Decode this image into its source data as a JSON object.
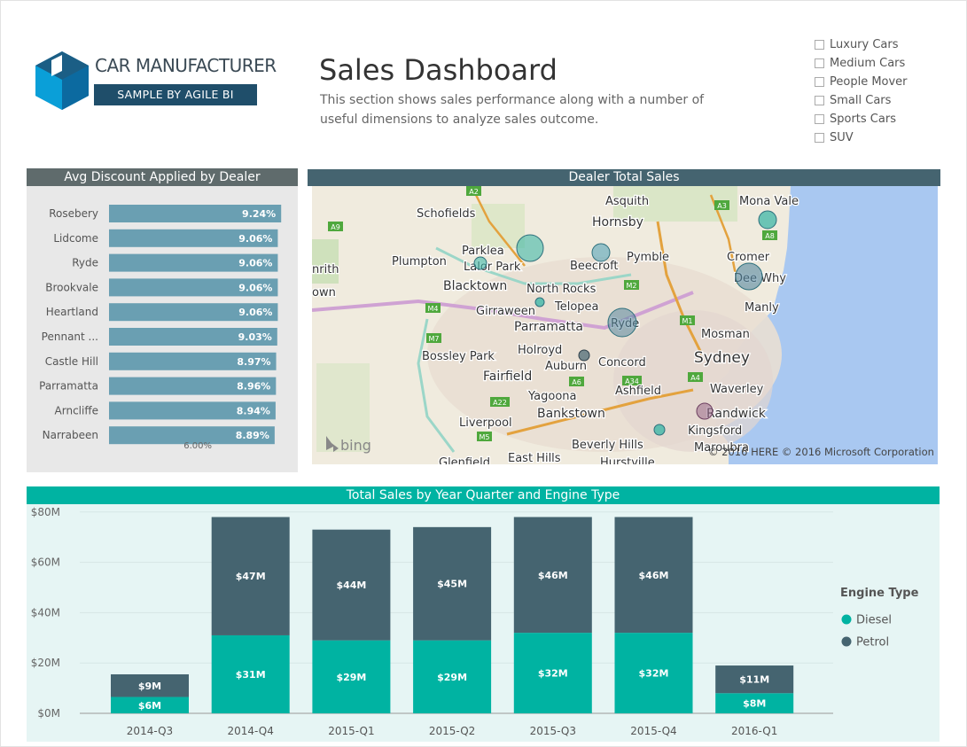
{
  "header": {
    "brand_name": "CAR MANUFACTURER",
    "brand_sub": "SAMPLE BY AGILE BI",
    "title": "Sales Dashboard",
    "description": "This section shows sales performance along with a number of useful dimensions to analyze sales outcome."
  },
  "slicer": {
    "items": [
      "Luxury Cars",
      "Medium Cars",
      "People Mover",
      "Small Cars",
      "Sports Cars",
      "SUV"
    ]
  },
  "colors": {
    "discount_bar": "#6a9fb2",
    "map_header": "#456470",
    "diesel": "#00b3a2",
    "petrol": "#456470",
    "sales_header": "#00b3a2"
  },
  "map": {
    "title": "Dealer Total Sales",
    "attribution": "© 2016 HERE   © 2016 Microsoft Corporation",
    "bing_logo": "bing",
    "places": [
      "Schofields",
      "Asquith",
      "Mona Vale",
      "Hornsby",
      "Parklea",
      "Lalor Park",
      "Plumpton",
      "Beecroft",
      "Pymble",
      "Cromer",
      "Dee Why",
      "Blacktown",
      "North Rocks",
      "Girraween",
      "Telopea",
      "Manly",
      "Parramatta",
      "Ryde",
      "Mosman",
      "Holroyd",
      "Bossley Park",
      "Auburn",
      "Concord",
      "Sydney",
      "Fairfield",
      "Ashfield",
      "Yagoona",
      "Waverley",
      "Bankstown",
      "Randwick",
      "Liverpool",
      "Kingsford",
      "Beverly Hills",
      "Maroubra",
      "East Hills",
      "nrith",
      "own",
      "Glenfield",
      "Hurstville"
    ],
    "road_labels": [
      "A2",
      "A9",
      "A3",
      "A8",
      "M2",
      "M4",
      "M7",
      "M1",
      "A6",
      "A4",
      "A22",
      "A34",
      "M5"
    ]
  },
  "chart_data": [
    {
      "type": "bar",
      "title": "Avg Discount Applied by Dealer",
      "categories": [
        "Rosebery",
        "Lidcome",
        "Ryde",
        "Brookvale",
        "Heartland",
        "Pennant ...",
        "Castle Hill",
        "Parramatta",
        "Arncliffe",
        "Narrabeen"
      ],
      "values": [
        9.24,
        9.06,
        9.06,
        9.06,
        9.06,
        9.03,
        8.97,
        8.96,
        8.94,
        8.89
      ],
      "data_labels": [
        "9.24%",
        "9.06%",
        "9.06%",
        "9.06%",
        "9.06%",
        "9.03%",
        "8.97%",
        "8.96%",
        "8.94%",
        "8.89%"
      ],
      "reference_line_label": "6.00%",
      "orientation": "horizontal"
    },
    {
      "type": "bar",
      "stacked": true,
      "title": "Total Sales by Year Quarter and Engine Type",
      "categories": [
        "2014-Q3",
        "2014-Q4",
        "2015-Q1",
        "2015-Q2",
        "2015-Q3",
        "2015-Q4",
        "2016-Q1"
      ],
      "series": [
        {
          "name": "Diesel",
          "values": [
            6.5,
            31,
            29,
            29,
            32,
            32,
            8
          ],
          "labels": [
            "$6M",
            "$31M",
            "$29M",
            "$29M",
            "$32M",
            "$32M",
            "$8M"
          ]
        },
        {
          "name": "Petrol",
          "values": [
            9,
            47,
            44,
            45,
            46,
            46,
            11
          ],
          "labels": [
            "$9M",
            "$47M",
            "$44M",
            "$45M",
            "$46M",
            "$46M",
            "$11M"
          ]
        }
      ],
      "ylim": [
        0,
        80
      ],
      "yticks": [
        "$0M",
        "$20M",
        "$40M",
        "$60M",
        "$80M"
      ],
      "legend_title": "Engine Type",
      "legend_position": "right"
    }
  ]
}
